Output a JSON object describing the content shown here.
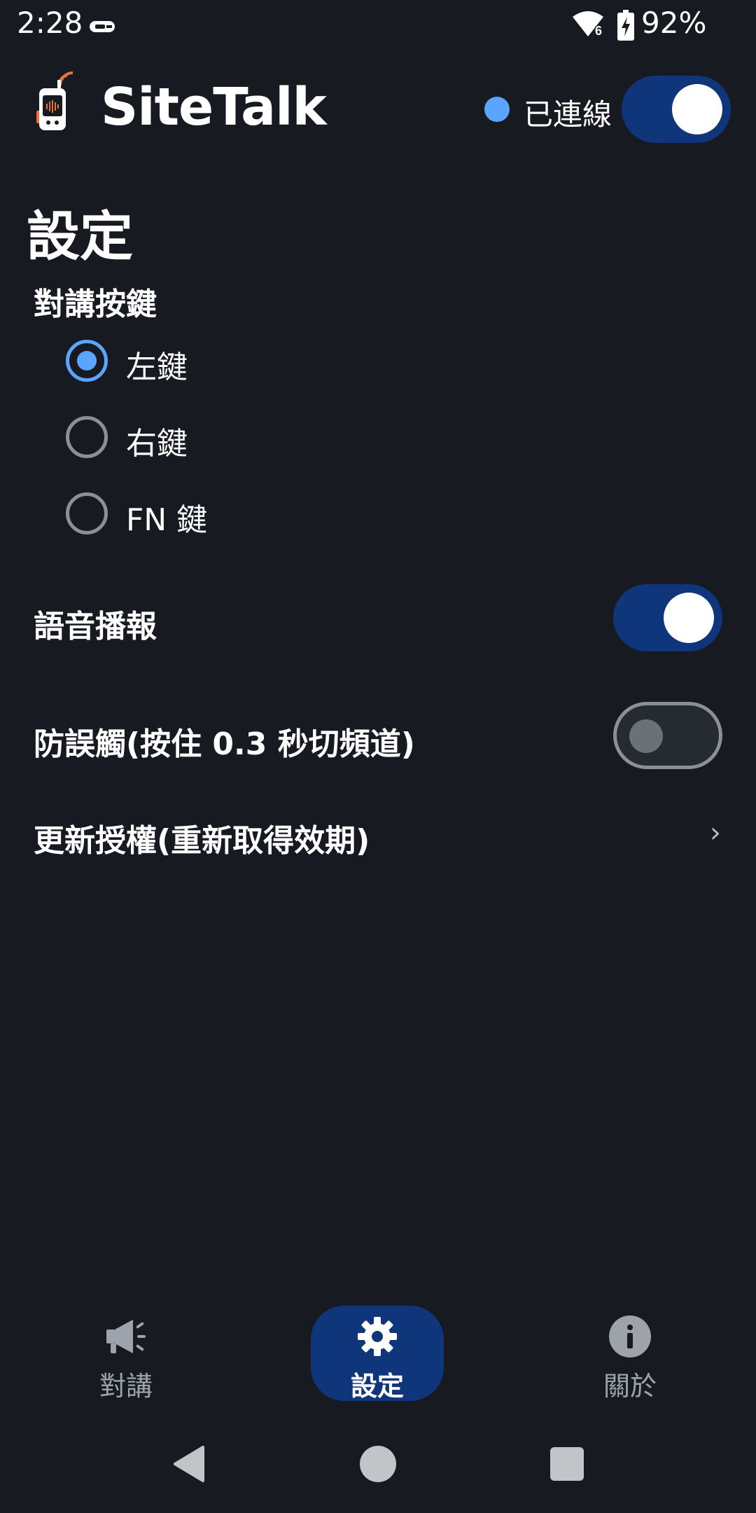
{
  "status_bar": {
    "time": "2:28",
    "battery": "92%",
    "wifi_badge": "6",
    "icons": [
      "usb-icon",
      "wifi-icon",
      "battery-charging-icon"
    ]
  },
  "header": {
    "app_title": "SiteTalk",
    "connection_label": "已連線",
    "connection_dot_color": "#5aa5ff",
    "connection_switch_on": true
  },
  "page": {
    "title": "設定",
    "ptt_section_label": "對講按鍵",
    "ptt_options": [
      {
        "label": "左鍵",
        "selected": true
      },
      {
        "label": "右鍵",
        "selected": false
      },
      {
        "label": "FN 鍵",
        "selected": false
      }
    ],
    "voice_announce": {
      "label": "語音播報",
      "on": true
    },
    "anti_mistouch": {
      "label": "防誤觸(按住 0.3 秒切頻道)",
      "on": false
    },
    "renew_license": {
      "label": "更新授權(重新取得效期)",
      "chevron": "›"
    }
  },
  "bottom_nav": {
    "items": [
      {
        "label": "對講",
        "icon": "megaphone-icon",
        "active": false
      },
      {
        "label": "設定",
        "icon": "gear-icon",
        "active": true
      },
      {
        "label": "關於",
        "icon": "info-icon",
        "active": false
      }
    ]
  },
  "colors": {
    "background": "#171a21",
    "accent": "#5aa5ff",
    "switch_on": "#0f357a",
    "text_muted": "#9ea3ab"
  }
}
